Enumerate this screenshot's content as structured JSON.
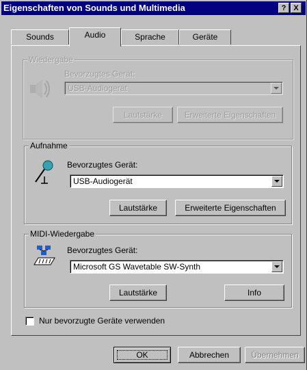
{
  "window": {
    "title": "Eigenschaften von Sounds und Multimedia",
    "help_button": "?",
    "close_button": "X"
  },
  "tabs": [
    {
      "label": "Sounds",
      "active": false
    },
    {
      "label": "Audio",
      "active": true
    },
    {
      "label": "Sprache",
      "active": false
    },
    {
      "label": "Geräte",
      "active": false
    }
  ],
  "playback": {
    "group_label": "Wiedergabe",
    "preferred_label": "Bevorzugtes Gerät:",
    "device": "USB-Audiogerät",
    "volume_button": "Lautstärke",
    "advanced_button": "Erweiterte Eigenschaften",
    "icon": "speaker-icon",
    "state": "ghosted"
  },
  "recording": {
    "group_label": "Aufnahme",
    "preferred_label": "Bevorzugtes Gerät:",
    "device": "USB-Audiogerät",
    "volume_button": "Lautstärke",
    "advanced_button": "Erweiterte Eigenschaften",
    "icon": "microphone-icon"
  },
  "midi": {
    "group_label": "MIDI-Wiedergabe",
    "preferred_label": "Bevorzugtes Gerät:",
    "device": "Microsoft GS Wavetable SW-Synth",
    "volume_button": "Lautstärke",
    "info_button": "Info",
    "icon": "midi-keyboard-icon"
  },
  "options": {
    "preferred_only_label": "Nur bevorzugte Geräte verwenden",
    "preferred_only_checked": false
  },
  "footer": {
    "ok": "OK",
    "cancel": "Abbrechen",
    "apply": "Übernehmen"
  },
  "colors": {
    "titlebar": "#000080",
    "face": "#c0c0c0",
    "disabled_text": "#808080"
  }
}
